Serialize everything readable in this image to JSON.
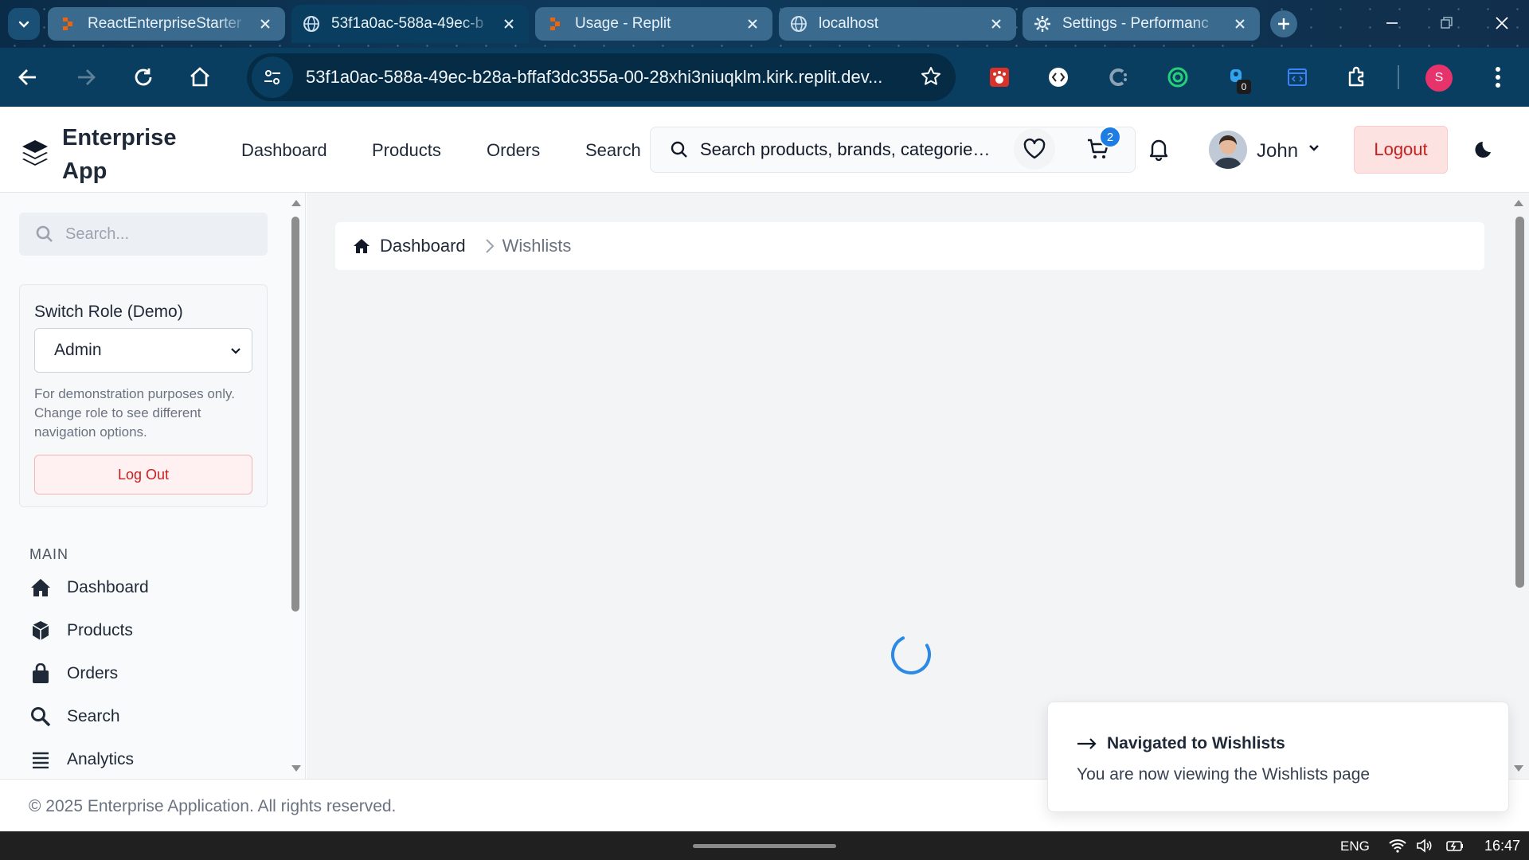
{
  "browser": {
    "tabs": [
      {
        "label": "ReactEnterpriseStarter",
        "icon": "replit-icon",
        "active": false
      },
      {
        "label": "53f1a0ac-588a-49ec-b",
        "icon": "globe-icon",
        "active": true
      },
      {
        "label": "Usage - Replit",
        "icon": "replit-icon",
        "active": false
      },
      {
        "label": "localhost",
        "icon": "globe-icon",
        "active": false
      },
      {
        "label": "Settings - Performanc",
        "icon": "gear-icon",
        "active": false
      }
    ],
    "url": "53f1a0ac-588a-49ec-b28a-bffaf3dc355a-00-28xhi3niuqklm.kirk.replit.dev...",
    "extension_badge": "0",
    "profile_initial": "S"
  },
  "header": {
    "brand": "Enterprise App",
    "nav": [
      "Dashboard",
      "Products",
      "Orders",
      "Search"
    ],
    "search_placeholder": "Search products, brands, categories...",
    "cart_count": "2",
    "user_name": "John",
    "logout_label": "Logout"
  },
  "sidebar": {
    "search_placeholder": "Search...",
    "role_card": {
      "title": "Switch Role (Demo)",
      "selected_role": "Admin",
      "help": "For demonstration purposes only. Change role to see different navigation options.",
      "logout_label": "Log Out"
    },
    "section_label": "MAIN",
    "items": [
      {
        "label": "Dashboard",
        "icon": "home-icon"
      },
      {
        "label": "Products",
        "icon": "cube-icon"
      },
      {
        "label": "Orders",
        "icon": "shopping-bag-icon"
      },
      {
        "label": "Search",
        "icon": "search-icon"
      },
      {
        "label": "Analytics",
        "icon": "bars-icon"
      }
    ]
  },
  "main": {
    "breadcrumb": {
      "home": "Dashboard",
      "current": "Wishlists"
    }
  },
  "footer": {
    "text": "© 2025 Enterprise Application. All rights reserved."
  },
  "toast": {
    "title": "Navigated to Wishlists",
    "description": "You are now viewing the Wishlists page"
  },
  "taskbar": {
    "lang": "ENG",
    "time": "16:47"
  },
  "colors": {
    "tab_strip": "#0b2c48",
    "toolbar": "#0a3e60",
    "accent_blue": "#1d7de3",
    "logout_red": "#c81e1e",
    "main_bg": "#f3f4f6"
  }
}
